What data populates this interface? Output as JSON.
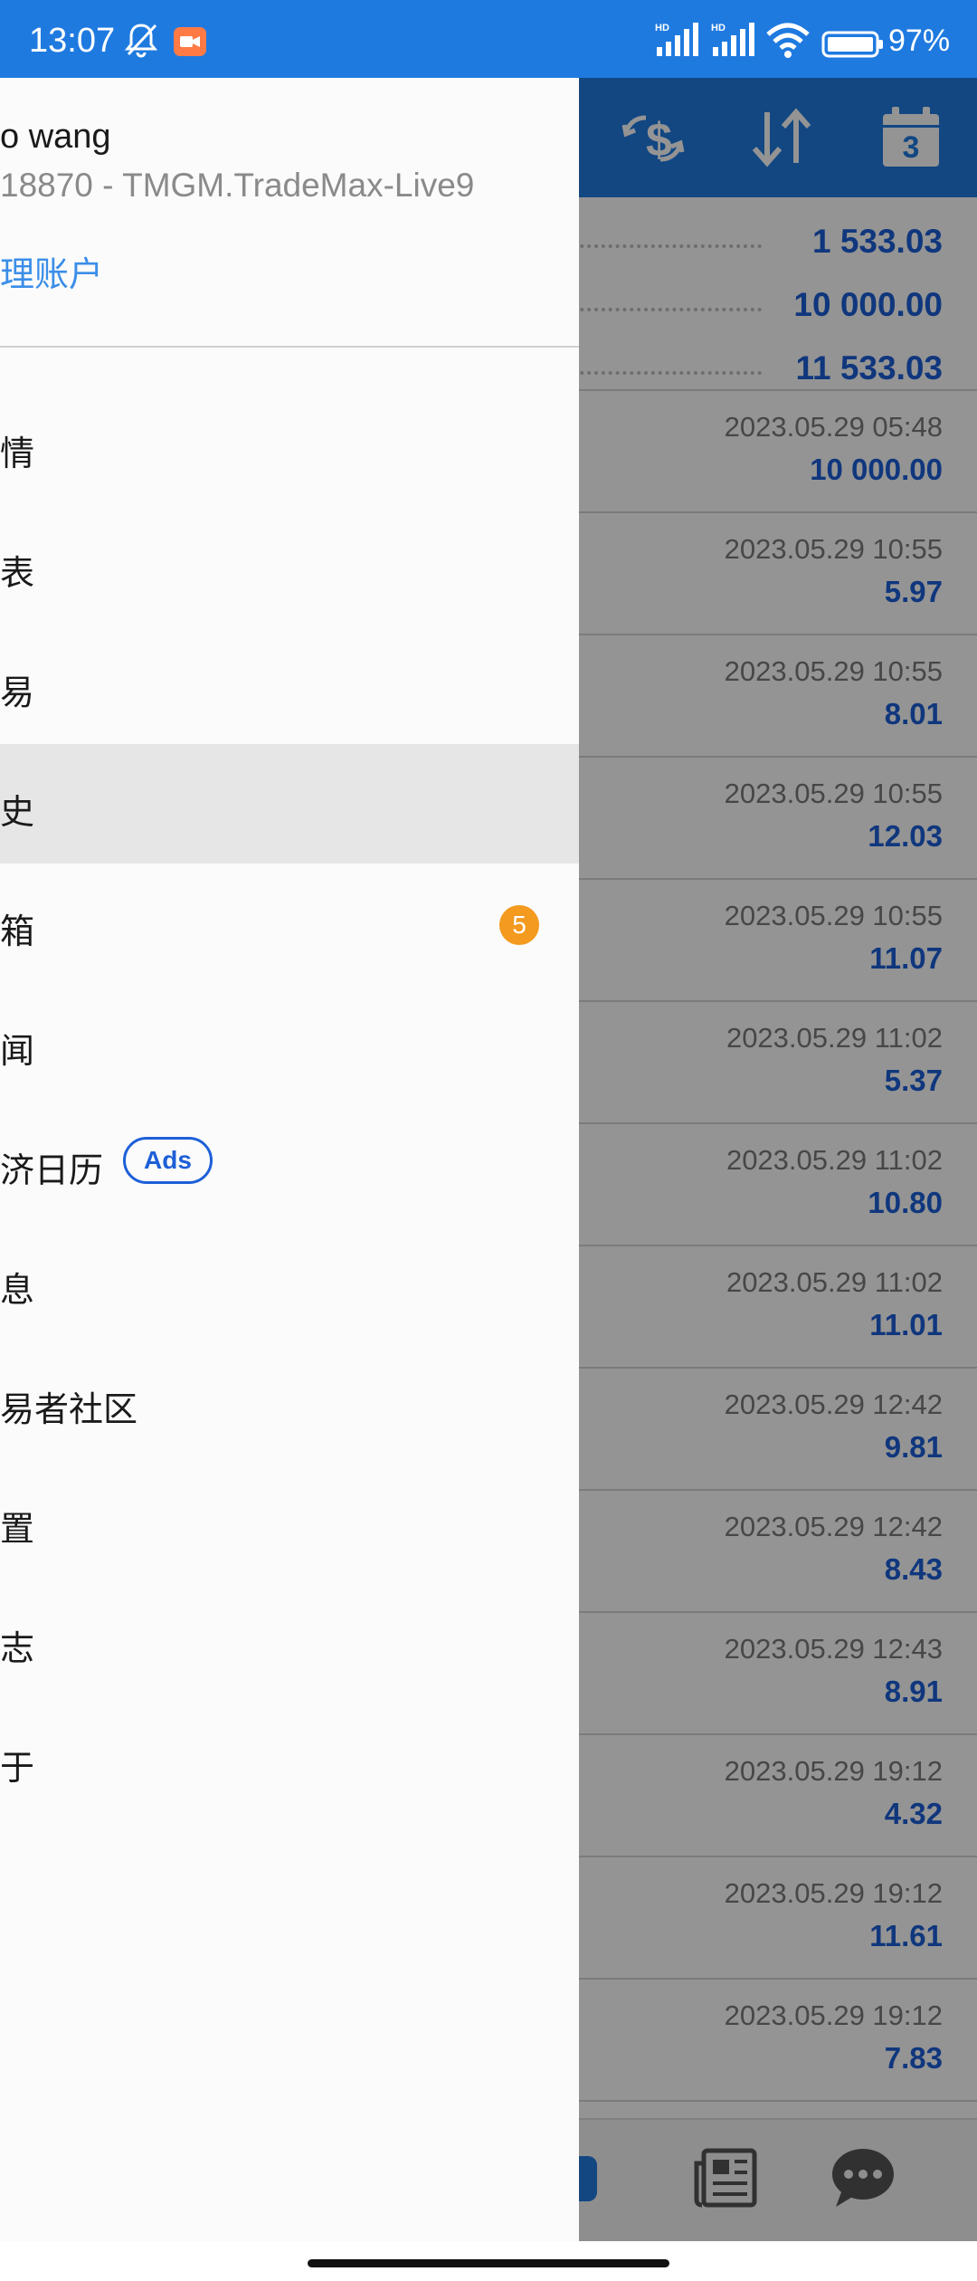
{
  "status_bar": {
    "time": "13:07",
    "battery_text": "97%",
    "icons": [
      "mute-bell-icon",
      "screen-record-icon",
      "hd-signal-icon",
      "hd-signal-icon",
      "wifi-icon",
      "battery-icon"
    ]
  },
  "toolbar": {
    "icons": [
      "currency-exchange-icon",
      "sort-arrows-icon",
      "calendar-icon"
    ],
    "calendar_day": "3"
  },
  "summary": {
    "values": [
      "1 533.03",
      "10 000.00",
      "11 533.03"
    ]
  },
  "deals": [
    {
      "time": "2023.05.29 05:48",
      "amount": "10 000.00"
    },
    {
      "time": "2023.05.29 10:55",
      "amount": "5.97"
    },
    {
      "time": "2023.05.29 10:55",
      "amount": "8.01"
    },
    {
      "time": "2023.05.29 10:55",
      "amount": "12.03"
    },
    {
      "time": "2023.05.29 10:55",
      "amount": "11.07"
    },
    {
      "time": "2023.05.29 11:02",
      "amount": "5.37"
    },
    {
      "time": "2023.05.29 11:02",
      "amount": "10.80"
    },
    {
      "time": "2023.05.29 11:02",
      "amount": "11.01"
    },
    {
      "time": "2023.05.29 12:42",
      "amount": "9.81"
    },
    {
      "time": "2023.05.29 12:42",
      "amount": "8.43"
    },
    {
      "time": "2023.05.29 12:43",
      "amount": "8.91"
    },
    {
      "time": "2023.05.29 19:12",
      "amount": "4.32"
    },
    {
      "time": "2023.05.29 19:12",
      "amount": "11.61"
    },
    {
      "time": "2023.05.29 19:12",
      "amount": "7.83"
    }
  ],
  "bottom_nav": {
    "icons": [
      "history-tab-icon",
      "news-icon",
      "chat-icon"
    ]
  },
  "drawer": {
    "account_name": "o wang",
    "account_server": "18870 - TMGM.TradeMax-Live9",
    "manage_accounts": "理账户",
    "items": [
      {
        "label": "情"
      },
      {
        "label": "表"
      },
      {
        "label": "易"
      },
      {
        "label": "史",
        "selected": true
      },
      {
        "label": "箱",
        "badge": "5"
      },
      {
        "label": "闻"
      },
      {
        "label": "济日历",
        "tag": "Ads"
      },
      {
        "label": "息"
      },
      {
        "label": "易者社区"
      },
      {
        "label": "置"
      },
      {
        "label": "志"
      },
      {
        "label": "于"
      }
    ]
  },
  "colors": {
    "primary": "#1f7ae0",
    "value_blue": "#1d5fd8",
    "badge_orange": "#f39a1f",
    "link_blue": "#3b8ee8"
  }
}
